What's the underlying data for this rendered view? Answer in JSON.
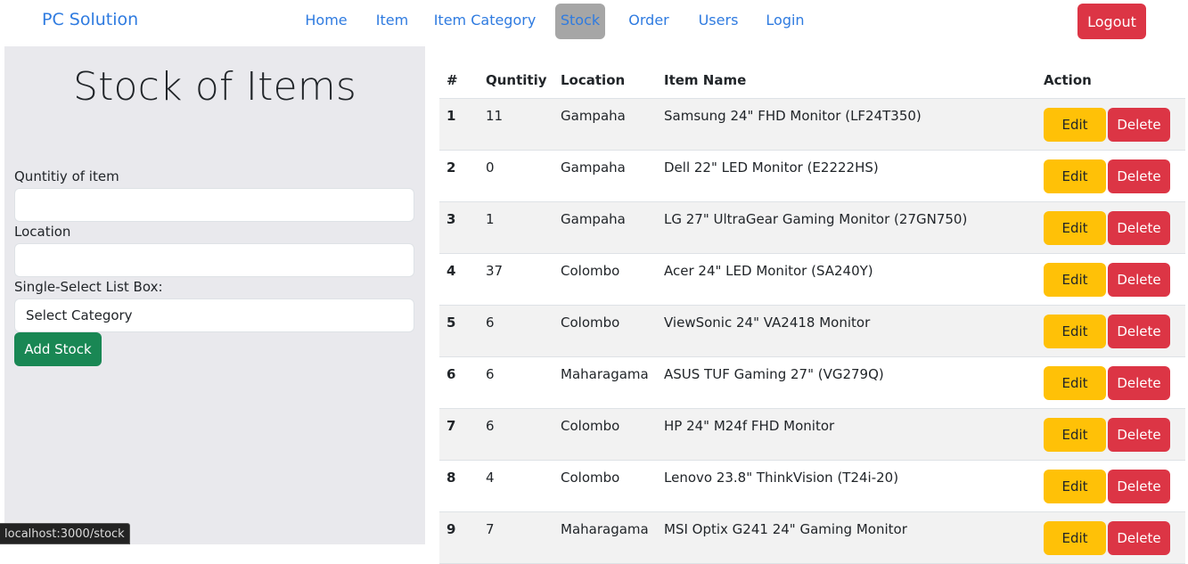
{
  "navbar": {
    "brand": "PC Solution",
    "links": [
      {
        "label": "Home",
        "active": false
      },
      {
        "label": "Item",
        "active": false
      },
      {
        "label": "Item Category",
        "active": false
      },
      {
        "label": "Stock",
        "active": true
      },
      {
        "label": "Order",
        "active": false
      },
      {
        "label": "Users",
        "active": false
      },
      {
        "label": "Login",
        "active": false
      }
    ],
    "logout_label": "Logout"
  },
  "form": {
    "title": "Stock of Items",
    "quantity_label": "Quntitiy of item",
    "quantity_value": "",
    "location_label": "Location",
    "location_value": "",
    "category_label": "Single-Select List Box:",
    "category_selected": "Select Category",
    "submit_label": "Add Stock"
  },
  "table": {
    "headers": [
      "#",
      "Quntitiy",
      "Location",
      "Item Name",
      "Action"
    ],
    "edit_label": "Edit",
    "delete_label": "Delete",
    "rows": [
      {
        "num": "1",
        "quantity": "11",
        "location": "Gampaha",
        "item": "Samsung 24\" FHD Monitor (LF24T350)"
      },
      {
        "num": "2",
        "quantity": "0",
        "location": "Gampaha",
        "item": "Dell 22\" LED Monitor (E2222HS)"
      },
      {
        "num": "3",
        "quantity": "1",
        "location": "Gampaha",
        "item": "LG 27\" UltraGear Gaming Monitor (27GN750)"
      },
      {
        "num": "4",
        "quantity": "37",
        "location": "Colombo",
        "item": "Acer 24\" LED Monitor (SA240Y)"
      },
      {
        "num": "5",
        "quantity": "6",
        "location": "Colombo",
        "item": "ViewSonic 24\" VA2418 Monitor"
      },
      {
        "num": "6",
        "quantity": "6",
        "location": "Maharagama",
        "item": "ASUS TUF Gaming 27\" (VG279Q)"
      },
      {
        "num": "7",
        "quantity": "6",
        "location": "Colombo",
        "item": "HP 24\" M24f FHD Monitor"
      },
      {
        "num": "8",
        "quantity": "4",
        "location": "Colombo",
        "item": "Lenovo 23.8\" ThinkVision (T24i-20)"
      },
      {
        "num": "9",
        "quantity": "7",
        "location": "Maharagama",
        "item": "MSI Optix G241 24\" Gaming Monitor"
      }
    ]
  },
  "status_bar": {
    "url": "localhost:3000/stock"
  }
}
